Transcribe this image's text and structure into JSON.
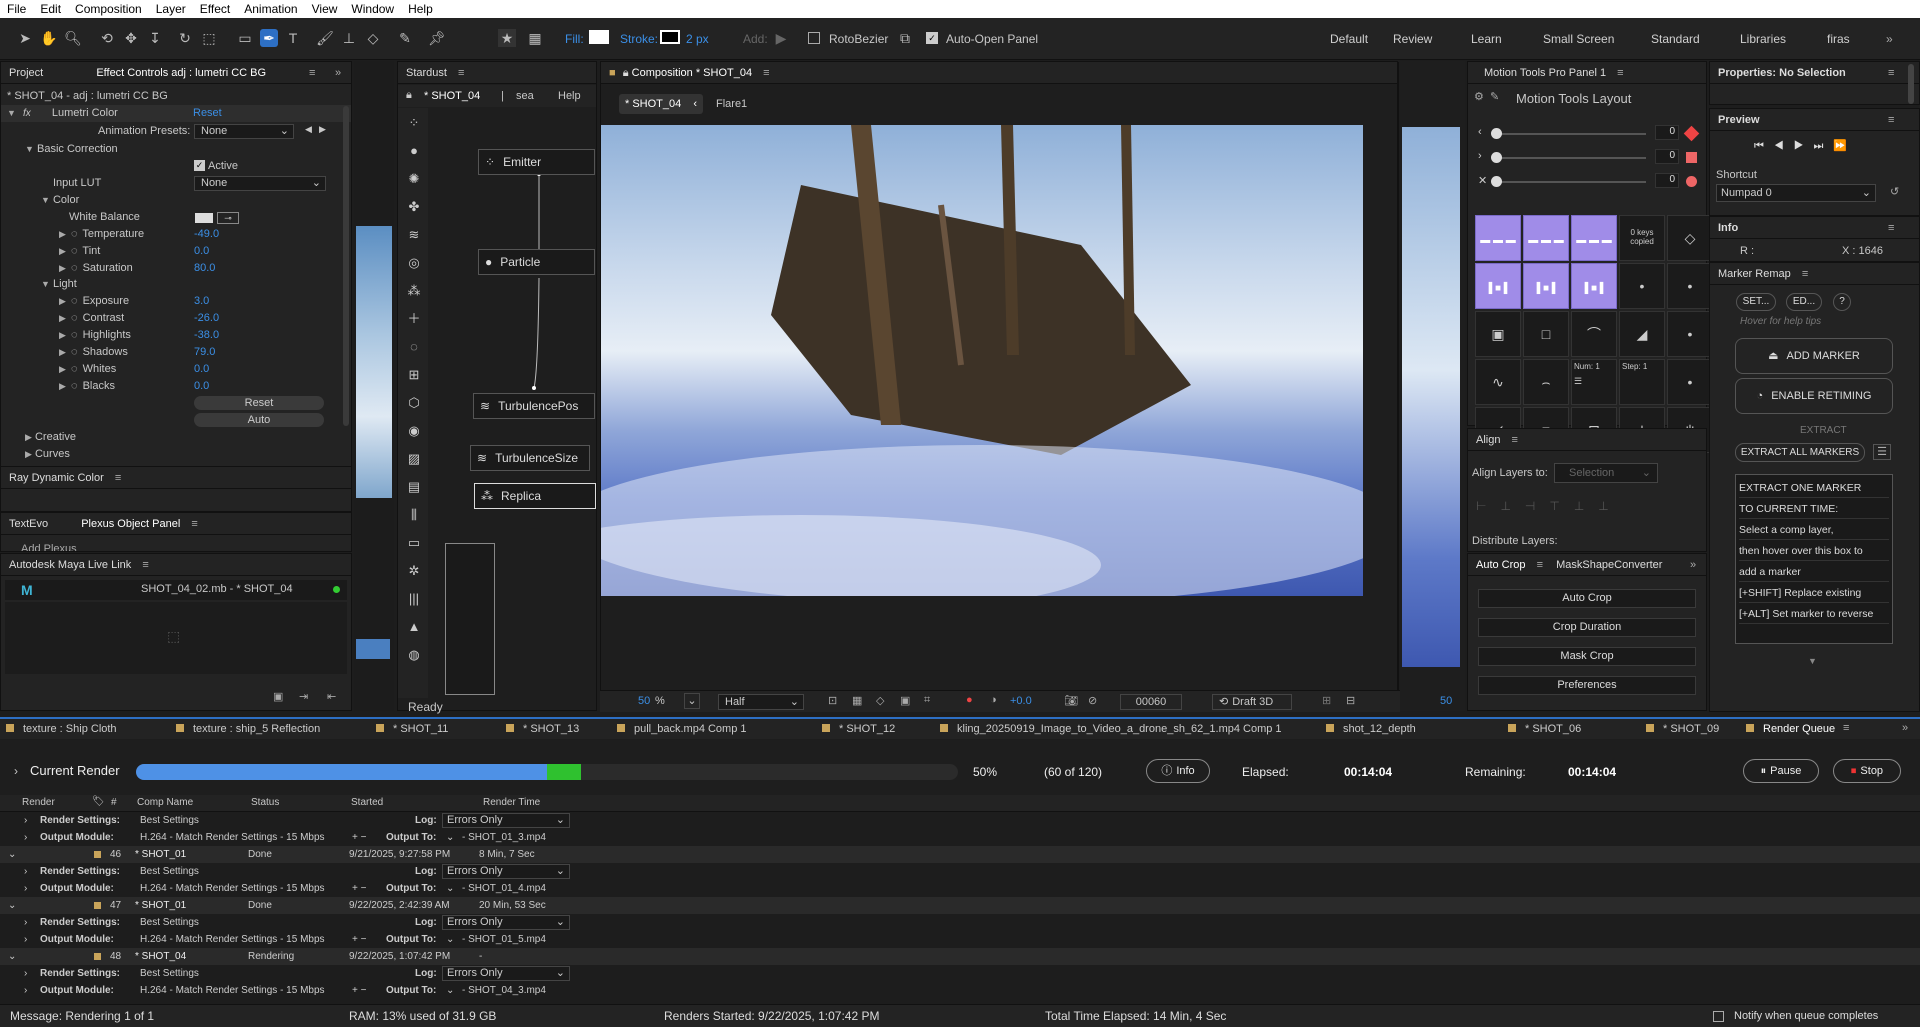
{
  "menu": [
    "File",
    "Edit",
    "Composition",
    "Layer",
    "Effect",
    "Animation",
    "View",
    "Window",
    "Help"
  ],
  "toolbar": {
    "fill_label": "Fill:",
    "stroke_label": "Stroke:",
    "stroke_px": "2 px",
    "add_label": "Add:",
    "rotobezier": "RotoBezier",
    "auto_open": "Auto-Open Panel"
  },
  "workspaces": [
    "Default",
    "Review",
    "Learn",
    "Small Screen",
    "Standard",
    "Libraries",
    "firas"
  ],
  "left": {
    "project_tab": "Project",
    "effect_tab": "Effect Controls adj : lumetri CC BG",
    "layer_path": "* SHOT_04 - adj : lumetri CC BG",
    "effect_name": "Lumetri Color",
    "reset": "Reset",
    "anim_presets": "Animation Presets:",
    "anim_presets_val": "None",
    "basic": "Basic Correction",
    "active": "Active",
    "input_lut": "Input LUT",
    "input_lut_val": "None",
    "color": "Color",
    "white_balance": "White Balance",
    "params": [
      {
        "n": "Temperature",
        "v": "-49.0"
      },
      {
        "n": "Tint",
        "v": "0.0"
      },
      {
        "n": "Saturation",
        "v": "80.0"
      }
    ],
    "light": "Light",
    "light_params": [
      {
        "n": "Exposure",
        "v": "3.0"
      },
      {
        "n": "Contrast",
        "v": "-26.0"
      },
      {
        "n": "Highlights",
        "v": "-38.0"
      },
      {
        "n": "Shadows",
        "v": "79.0"
      },
      {
        "n": "Whites",
        "v": "0.0"
      },
      {
        "n": "Blacks",
        "v": "0.0"
      }
    ],
    "reset_btn": "Reset",
    "auto_btn": "Auto",
    "creative": "Creative",
    "curves": "Curves",
    "ray": "Ray Dynamic Color",
    "textevo": "TextEvo",
    "plexus": "Plexus Object Panel",
    "add_plexus": "Add Plexus",
    "maya": "Autodesk Maya Live Link",
    "maya_file": "SHOT_04_02.mb - * SHOT_04"
  },
  "stardust": {
    "title": "Stardust",
    "tab": "* SHOT_04",
    "sep": "|",
    "sea": "sea",
    "help": "Help",
    "status": "Ready",
    "nodes": [
      "Emitter",
      "Particle",
      "TurbulencePos",
      "TurbulenceSize",
      "Replica"
    ]
  },
  "comp": {
    "title": "Composition * SHOT_04",
    "tab1": "* SHOT_04",
    "tab2": "Flare1",
    "zoom": "50",
    "zoom_unit": "%",
    "res": "Half",
    "exposure": "+0.0",
    "frame": "00060",
    "renderer": "Draft 3D",
    "right_zoom": "50"
  },
  "motion": {
    "title": "Motion Tools Pro Panel 1",
    "layout": "Motion Tools Layout",
    "v1": "0",
    "v2": "0",
    "v3": "0",
    "keys": "0 keys copied",
    "num": "Num: 1",
    "step": "Step: 1"
  },
  "align": {
    "title": "Align",
    "layers_to": "Align Layers to:",
    "sel": "Selection",
    "dist": "Distribute Layers:"
  },
  "autocrop": {
    "tab1": "Auto Crop",
    "tab2": "MaskShapeConverter",
    "b1": "Auto Crop",
    "b2": "Crop Duration",
    "b3": "Mask Crop",
    "b4": "Preferences"
  },
  "props": {
    "title": "Properties: No Selection",
    "preview": "Preview",
    "shortcut": "Shortcut",
    "shortcut_val": "Numpad 0",
    "info": "Info",
    "info_r": "R :",
    "info_x": "X : 1646"
  },
  "marker": {
    "title": "Marker Remap",
    "set": "SET...",
    "ed": "ED...",
    "q": "?",
    "hover": "Hover for help tips",
    "add": "ADD MARKER",
    "retime": "ENABLE RETIMING",
    "extract": "EXTRACT",
    "extract_all": "EXTRACT ALL MARKERS",
    "help": [
      "EXTRACT ONE MARKER",
      "TO CURRENT TIME:",
      "Select a comp layer,",
      "then hover over this box to",
      "add a marker",
      "[+SHIFT] Replace existing",
      "[+ALT] Set marker to reverse"
    ]
  },
  "tabs": [
    "texture : Ship Cloth",
    "texture : ship_5 Reflection",
    "* SHOT_11",
    "* SHOT_13",
    "pull_back.mp4 Comp 1",
    "* SHOT_12",
    "kling_20250919_Image_to_Video_a_drone_sh_62_1.mp4 Comp 1",
    "shot_12_depth",
    "* SHOT_06",
    "* SHOT_09",
    "Render Queue"
  ],
  "render": {
    "current": "Current Render",
    "progress": 0.5,
    "pct": "50%",
    "frames": "(60 of 120)",
    "info": "Info",
    "elapsed_l": "Elapsed:",
    "elapsed": "00:14:04",
    "remaining_l": "Remaining:",
    "remaining": "00:14:04",
    "pause": "Pause",
    "stop": "Stop",
    "cols": [
      "Render",
      "#",
      "Comp Name",
      "Status",
      "Started",
      "Render Time"
    ],
    "rs": "Render Settings:",
    "best": "Best Settings",
    "om": "Output Module:",
    "h264": "H.264 - Match Render Settings - 15 Mbps",
    "log": "Log:",
    "errors": "Errors Only",
    "out_to": "Output To:",
    "items": [
      {
        "n": "46",
        "comp": "* SHOT_01",
        "status": "Done",
        "started": "9/21/2025, 9:27:58 PM",
        "time": "8 Min, 7 Sec",
        "out": "- SHOT_01_4.mp4"
      },
      {
        "n": "47",
        "comp": "* SHOT_01",
        "status": "Done",
        "started": "9/22/2025, 2:42:39 AM",
        "time": "20 Min, 53 Sec",
        "out": "- SHOT_01_5.mp4"
      },
      {
        "n": "48",
        "comp": "* SHOT_04",
        "status": "Rendering",
        "started": "9/22/2025, 1:07:42 PM",
        "time": "-",
        "out": "- SHOT_04_3.mp4"
      }
    ],
    "first_out": "- SHOT_01_3.mp4"
  },
  "status": {
    "message": "Message: Rendering 1 of 1",
    "ram": "RAM: 13% used of 31.9 GB",
    "started": "Renders Started: 9/22/2025, 1:07:42 PM",
    "total": "Total Time Elapsed: 14 Min, 4 Sec",
    "notify": "Notify when queue completes"
  }
}
